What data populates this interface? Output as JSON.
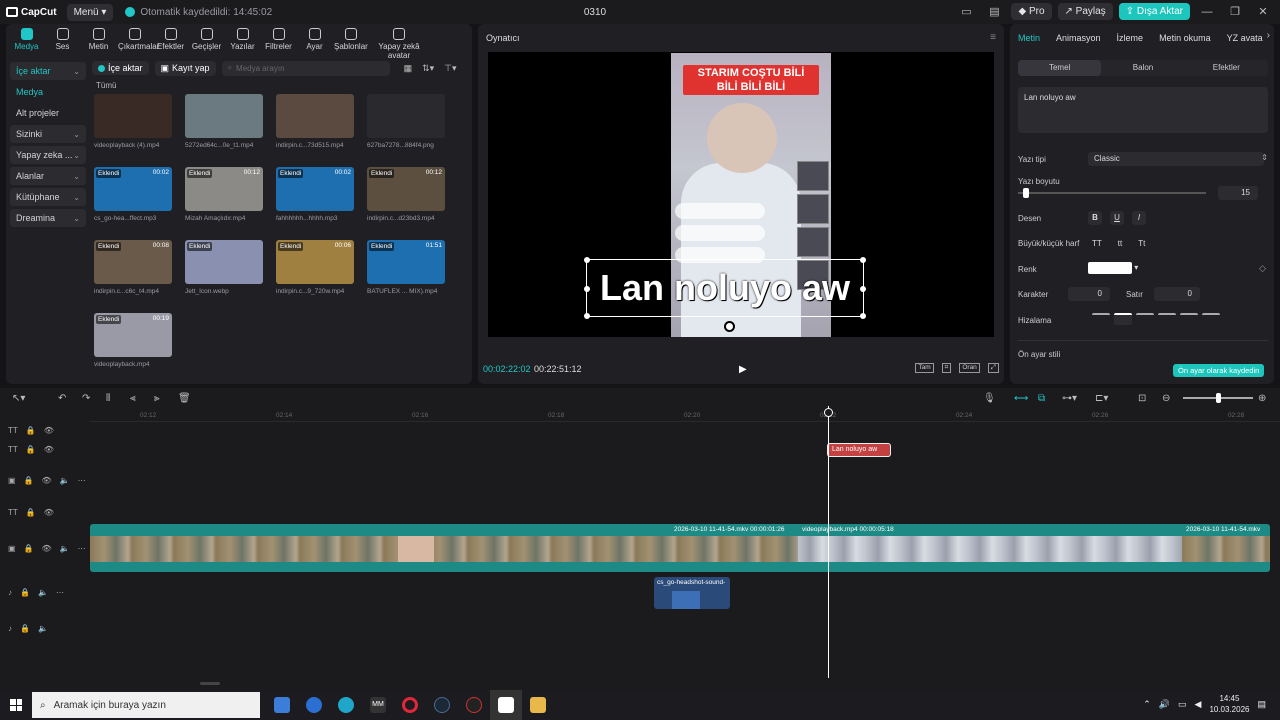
{
  "app": {
    "logo": "CapCut",
    "menu_label": "Menü",
    "autosave": "Otomatik kaydedildi: 14:45:02",
    "project_title": "0310",
    "pro_label": "Pro",
    "share_label": "Paylaş",
    "export_label": "Dışa Aktar"
  },
  "tool_tabs": [
    {
      "label": "Medya",
      "icon": "media-icon",
      "active": true
    },
    {
      "label": "Ses",
      "icon": "audio-icon"
    },
    {
      "label": "Metin",
      "icon": "text-icon"
    },
    {
      "label": "Çıkartmalar",
      "icon": "sticker-icon"
    },
    {
      "label": "Efektler",
      "icon": "effects-icon"
    },
    {
      "label": "Geçişler",
      "icon": "transitions-icon"
    },
    {
      "label": "Yazılar",
      "icon": "captions-icon"
    },
    {
      "label": "Filtreler",
      "icon": "filters-icon"
    },
    {
      "label": "Ayar",
      "icon": "adjust-icon"
    },
    {
      "label": "Şablonlar",
      "icon": "templates-icon"
    },
    {
      "label": "Yapay zekâ avatar",
      "icon": "ai-avatar-icon"
    }
  ],
  "sidebar": [
    {
      "label": "İçe aktar",
      "state": "active"
    },
    {
      "label": "Medya",
      "state": "sub"
    },
    {
      "label": "Alt projeler",
      "state": "plain"
    },
    {
      "label": "Sizinki",
      "state": "box"
    },
    {
      "label": "Yapay zeka ...",
      "state": "box"
    },
    {
      "label": "Alanlar",
      "state": "box"
    },
    {
      "label": "Kütüphane",
      "state": "box"
    },
    {
      "label": "Dreamina",
      "state": "box"
    }
  ],
  "media_toolbar": {
    "import_label": "İçe aktar",
    "record_label": "Kayıt yap",
    "search_placeholder": "Medya arayın",
    "all_label": "Tümü"
  },
  "media_items": [
    {
      "label": "videoplayback (4).mp4",
      "badge": "",
      "duration": "",
      "color": "#3a2a26"
    },
    {
      "label": "5272ed64c...0e_t1.mp4",
      "badge": "",
      "duration": "",
      "color": "#6b7a80"
    },
    {
      "label": "indirpin.c...73d515.mp4",
      "badge": "",
      "duration": "",
      "color": "#5a4a3f"
    },
    {
      "label": "627ba7278...884f4.png",
      "badge": "",
      "duration": "",
      "color": "#2a2a2e"
    },
    {
      "label": "cs_go-hea...ffect.mp3",
      "badge": "Eklendi",
      "duration": "00:02",
      "color": "#1d6fb0"
    },
    {
      "label": "Mizah Amaçlıdır.mp4",
      "badge": "Eklendi",
      "duration": "00:12",
      "color": "#8c8a86"
    },
    {
      "label": "fahhhhhh...hhhh.mp3",
      "badge": "Eklendi",
      "duration": "00:02",
      "color": "#1d6fb0"
    },
    {
      "label": "indirpin.c...d23bd3.mp4",
      "badge": "Eklendi",
      "duration": "00:12",
      "color": "#5c4f40"
    },
    {
      "label": "indirpin.c...c6c_t4.mp4",
      "badge": "Eklendi",
      "duration": "00:08",
      "color": "#6a5a4a"
    },
    {
      "label": "Jett_Icon.webp",
      "badge": "Eklendi",
      "duration": "",
      "color": "#8a90b0"
    },
    {
      "label": "indirpin.c...9_720w.mp4",
      "badge": "Eklendi",
      "duration": "00:06",
      "color": "#a08040"
    },
    {
      "label": "BATUFLEX ... MIX).mp4",
      "badge": "Eklendi",
      "duration": "01:51",
      "color": "#1d6fb0"
    },
    {
      "label": "videoplayback.mp4",
      "badge": "Eklendi",
      "duration": "00:19",
      "color": "#9a9aa6"
    }
  ],
  "player": {
    "title": "Oynatıcı",
    "banner_line1": "STARIM COŞTU BİLİ",
    "banner_line2": "BİLİ BİLİ BİLİ",
    "overlay_text": "Lan noluyo  aw",
    "current_time": "00:02:22:02",
    "total_time": "00:22:51:12",
    "btn_full": "Tam",
    "btn_ratio": "Oran"
  },
  "inspector": {
    "tabs": [
      "Metin",
      "Animasyon",
      "İzleme",
      "Metin okuma",
      "YZ avata"
    ],
    "subtabs": [
      "Temel",
      "Balon",
      "Efektler"
    ],
    "text_value": "Lan noluyo  aw",
    "font_label": "Yazı tipi",
    "font_value": "Classic",
    "size_label": "Yazı boyutu",
    "size_value": "15",
    "size_fraction": 0.04,
    "pattern_label": "Desen",
    "case_label": "Büyük/küçük harf",
    "case_options": [
      "TT",
      "tt",
      "Tt"
    ],
    "color_label": "Renk",
    "color_value": "#ffffff",
    "char_label": "Karakter",
    "char_value": "0",
    "line_label": "Satır",
    "line_value": "0",
    "align_label": "Hizalama",
    "preset_label": "Ön ayar stili",
    "save_preset_label": "Ön ayar olarak kaydedin"
  },
  "timeline": {
    "ruler": [
      "02:12",
      "02:14",
      "02:16",
      "02:18",
      "02:20",
      "02:22",
      "02:24",
      "02:26",
      "02:28"
    ],
    "text_clip": "Lan noluyo  aw",
    "clip1_label": "2026-03-10 11-41-54.mkv  00:00:01:26",
    "clip2_label": "videoplayback.mp4  00:00:05:18",
    "clip3_label": "2026-03-10 11-41-54.mkv",
    "audio_label": "cs_go-headshot-sound-"
  },
  "taskbar": {
    "search_placeholder": "Aramak için buraya yazın",
    "time": "14:45",
    "date": "10.03.2026"
  }
}
